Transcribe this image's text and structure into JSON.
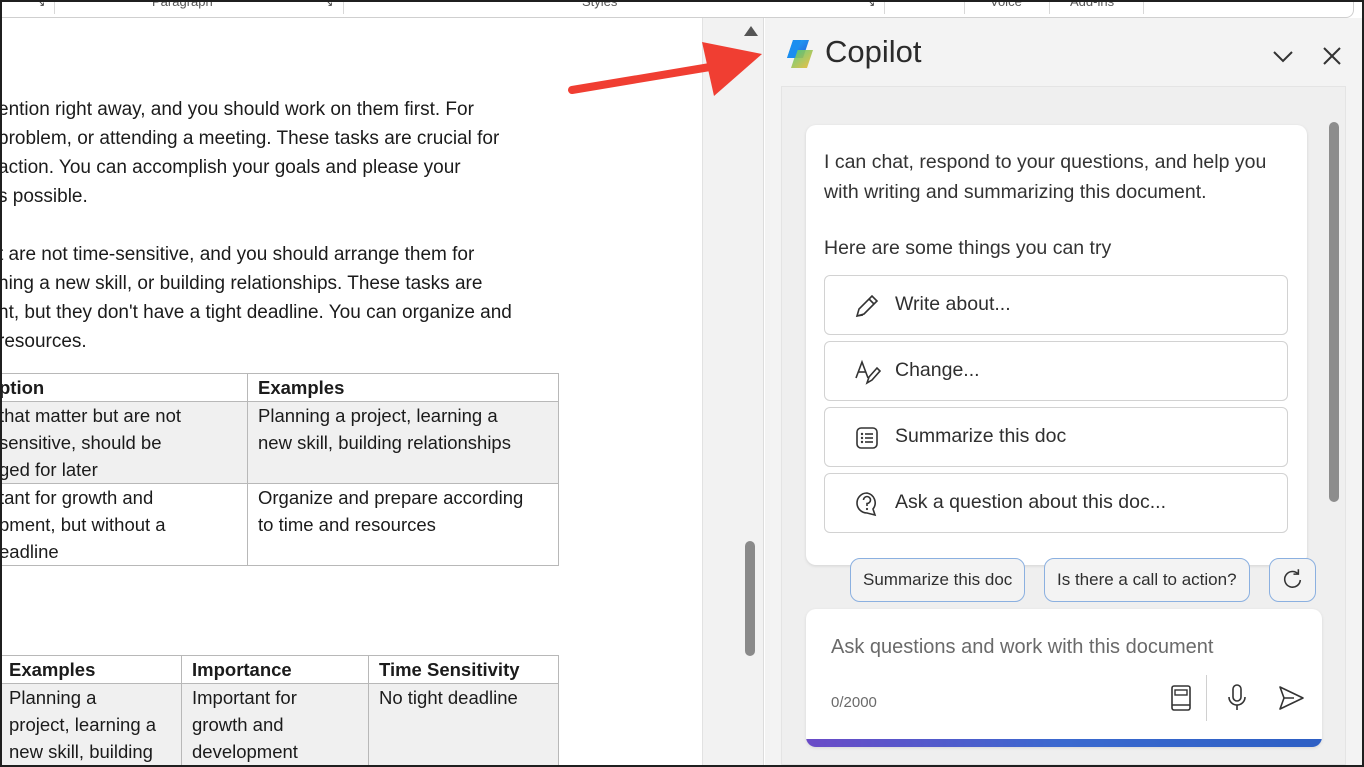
{
  "ribbon": {
    "groups": [
      "Paragraph",
      "Styles",
      "Voice",
      "Add-ins"
    ]
  },
  "document": {
    "paragraph1": [
      "ention right away, and you should work on them first. For",
      "problem, or attending a meeting. These tasks are crucial for",
      "action. You can accomplish your goals and please your",
      "s possible."
    ],
    "paragraph2": [
      "t are not time-sensitive, and you should arrange them for",
      "ning a new skill, or building relationships. These tasks are",
      "nt, but they don't have a tight deadline. You can organize and",
      "resources."
    ],
    "table1": {
      "headers": [
        "ption",
        "Examples"
      ],
      "rows": [
        [
          "that matter but are not\nsensitive, should be\nged for later",
          "Planning a project, learning a\nnew skill, building relationships"
        ],
        [
          "tant for growth and\npment, but without a\neadline",
          "Organize and prepare according\nto time and resources"
        ]
      ]
    },
    "table2": {
      "headers": [
        "Examples",
        "Importance",
        "Time Sensitivity"
      ],
      "rows": [
        [
          "Planning a\nproject, learning a\nnew skill, building",
          "Important for\ngrowth and\ndevelopment",
          "No tight deadline"
        ]
      ]
    }
  },
  "copilot": {
    "title": "Copilot",
    "intro": "I can chat, respond to your questions, and help you with writing and summarizing this document.",
    "try_heading": "Here are some things you can try",
    "suggestions": [
      {
        "label": "Write about...",
        "icon": "pen-icon"
      },
      {
        "label": "Change...",
        "icon": "rewrite-icon"
      },
      {
        "label": "Summarize this doc",
        "icon": "list-icon"
      },
      {
        "label": "Ask a question about this doc...",
        "icon": "question-chat-icon"
      }
    ],
    "chips": [
      "Summarize this doc",
      "Is there a call to action?"
    ],
    "composer": {
      "placeholder": "Ask questions and work with this document",
      "counter": "0/2000"
    }
  },
  "colors": {
    "arrow": "#f03e32",
    "chip_border": "#8bb0e0",
    "accent_gradient_start": "#6a4bc7",
    "accent_gradient_end": "#2d5fc4"
  }
}
